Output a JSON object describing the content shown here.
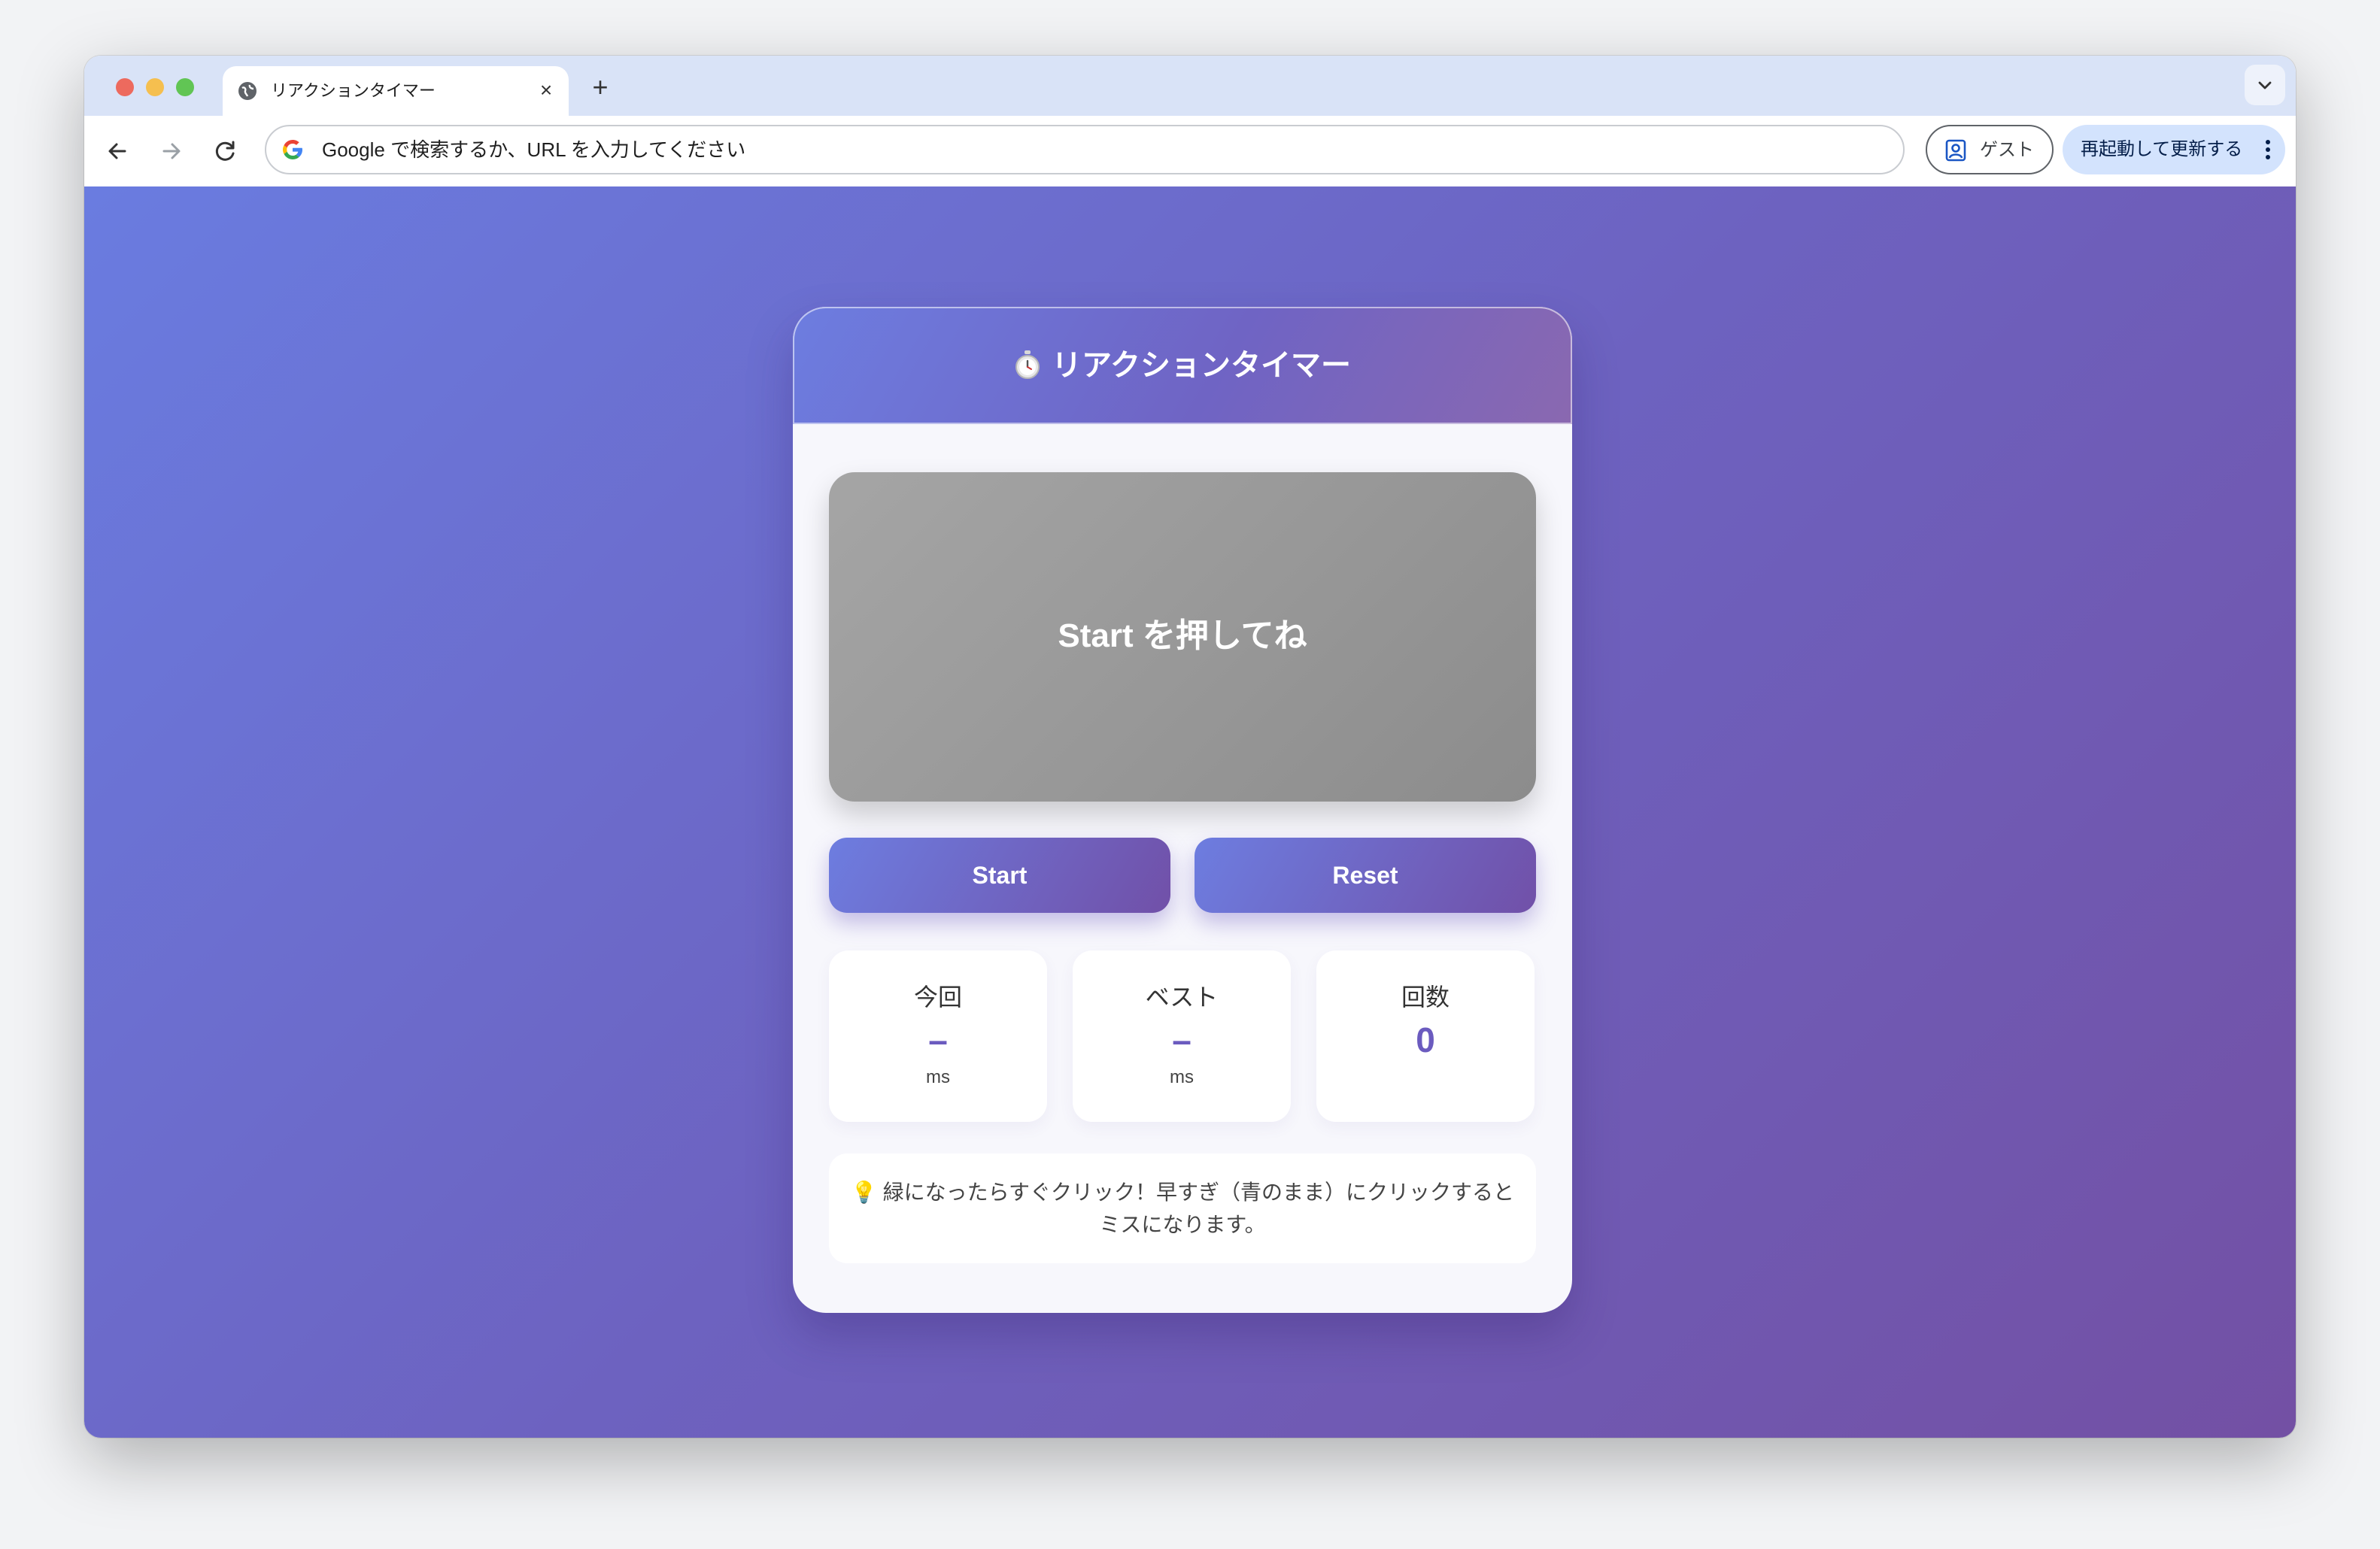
{
  "browser": {
    "tab_title": "リアクションタイマー",
    "tab_close": "×",
    "new_tab": "+",
    "omnibox_placeholder": "Google で検索するか、URL を入力してください",
    "guest_label": "ゲスト",
    "restart_label": "再起動して更新する"
  },
  "app": {
    "title": "リアクションタイマー",
    "pad_text": "Start を押してね",
    "start_label": "Start",
    "reset_label": "Reset",
    "stats": [
      {
        "label": "今回",
        "value": "–",
        "unit": "ms"
      },
      {
        "label": "ベスト",
        "value": "–",
        "unit": "ms"
      },
      {
        "label": "回数",
        "value": "0"
      }
    ],
    "hint_icon": "💡",
    "hint_text": "緑になったらすぐクリック！早すぎ（青のまま）にクリックするとミスになります。",
    "colors": {
      "accent": "#6b5bbf",
      "gradient_start": "#6a7ce0",
      "gradient_end": "#7350a4",
      "pad_idle": "#999999"
    }
  }
}
